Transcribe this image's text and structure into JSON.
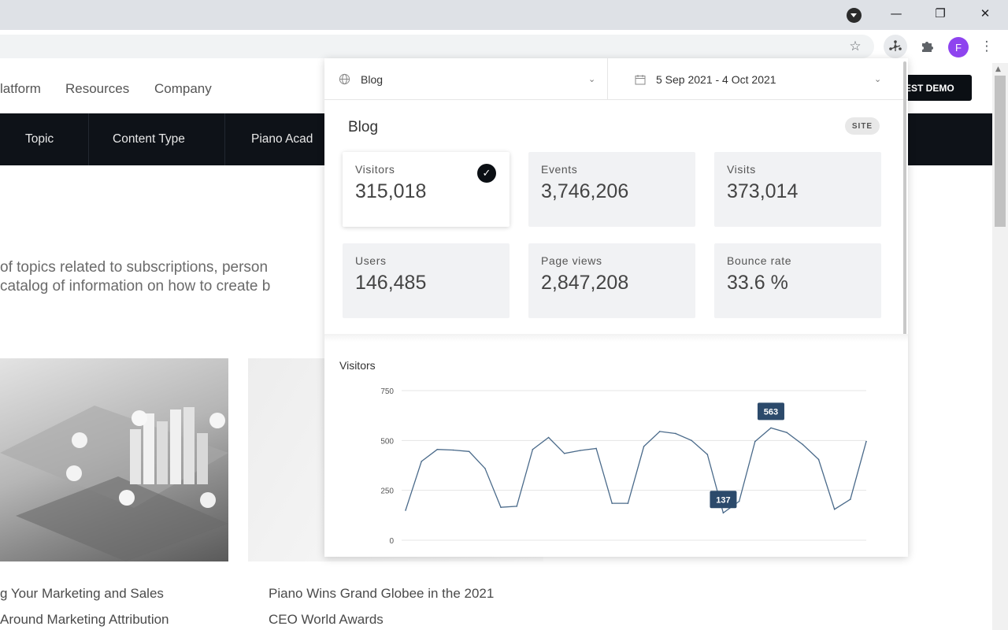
{
  "browser": {
    "window_controls": {
      "minimize": "—",
      "restore": "❐",
      "close": "✕"
    },
    "toolbar_icons": [
      "star-icon",
      "extension-active-icon",
      "puzzle-icon",
      "kebab-menu-icon"
    ],
    "avatar_initial": "F",
    "avatar_color": "#8e44ef"
  },
  "site": {
    "nav_links": [
      "latform",
      "Resources",
      "Company"
    ],
    "demo_button": "EST DEMO",
    "dark_nav": [
      "Topic",
      "Content Type",
      "Piano Acad"
    ],
    "intro_lines": [
      "of topics related to subscriptions, person",
      "catalog of information on how to create b"
    ],
    "cards": [
      {
        "title_lines": [
          "g Your Marketing and Sales",
          "Around Marketing Attribution"
        ]
      },
      {
        "title_lines": [
          "Piano Wins Grand Globee in the 2021",
          "CEO World Awards"
        ]
      }
    ]
  },
  "popup": {
    "site_select": {
      "icon": "globe-icon",
      "value": "Blog"
    },
    "date_select": {
      "icon": "calendar-icon",
      "value": "5 Sep 2021 - 4 Oct 2021"
    },
    "site_title": "Blog",
    "site_badge": "SITE",
    "metrics": [
      {
        "label": "Visitors",
        "value": "315,018",
        "selected": true
      },
      {
        "label": "Events",
        "value": "3,746,206",
        "selected": false
      },
      {
        "label": "Visits",
        "value": "373,014",
        "selected": false
      },
      {
        "label": "Users",
        "value": "146,485",
        "selected": false
      },
      {
        "label": "Page views",
        "value": "2,847,208",
        "selected": false
      },
      {
        "label": "Bounce rate",
        "value": "33.6 %",
        "selected": false
      }
    ],
    "chart_title": "Visitors"
  },
  "chart_data": {
    "type": "line",
    "title": "Visitors",
    "ylim": [
      0,
      750
    ],
    "yticks": [
      0,
      250,
      500,
      750
    ],
    "x": [
      1,
      2,
      3,
      4,
      5,
      6,
      7,
      8,
      9,
      10,
      11,
      12,
      13,
      14,
      15,
      16,
      17,
      18,
      19,
      20,
      21,
      22,
      23,
      24,
      25,
      26,
      27,
      28,
      29,
      30
    ],
    "values": [
      150,
      395,
      455,
      452,
      445,
      360,
      165,
      170,
      455,
      515,
      435,
      450,
      460,
      185,
      185,
      470,
      545,
      535,
      500,
      430,
      137,
      195,
      495,
      563,
      540,
      480,
      405,
      155,
      205,
      495
    ],
    "annotations": [
      {
        "label": "563",
        "index": 23
      },
      {
        "label": "137",
        "index": 20
      }
    ],
    "line_color": "#4a6a8a",
    "annotation_color": "#2c4a6b"
  }
}
